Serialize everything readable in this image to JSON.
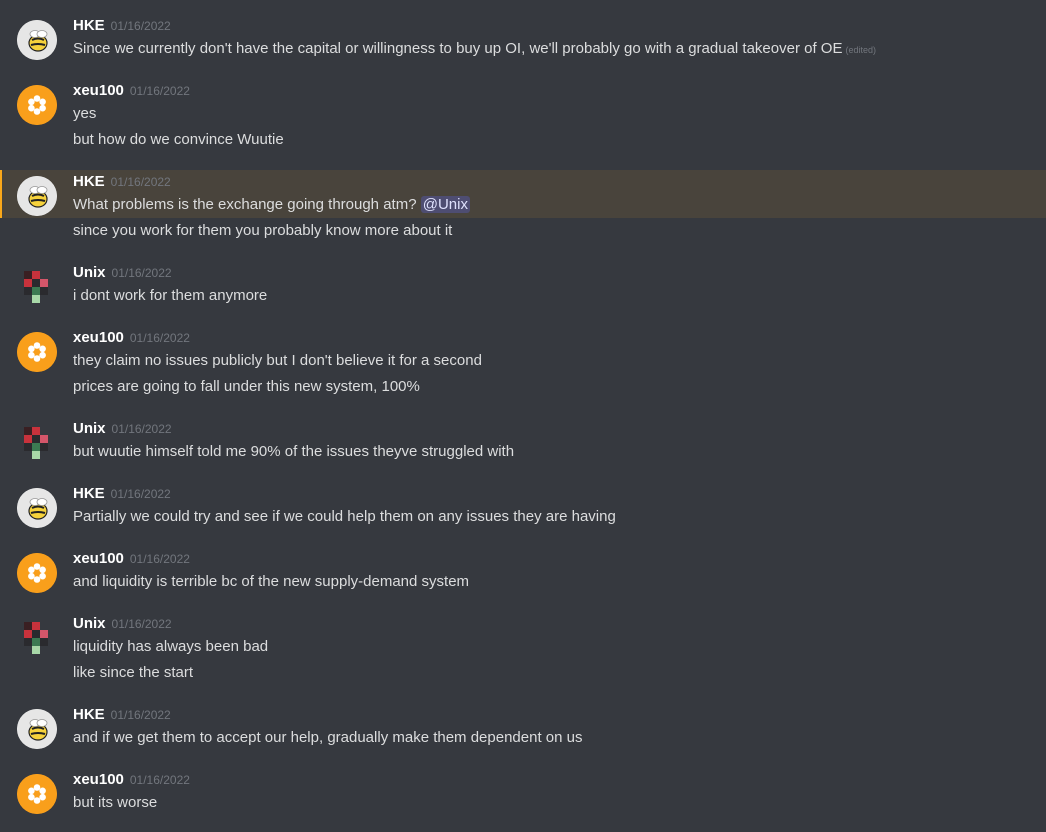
{
  "messages": [
    {
      "author": "HKE",
      "avatar": "bee-avatar",
      "timestamp": "01/16/2022",
      "lines": [
        "Since we currently don't have the capital or willingness to buy up OI, we'll probably go with a gradual takeover of OE"
      ],
      "edited_label": "(edited)"
    },
    {
      "author": "xeu100",
      "avatar": "orange-flower-avatar",
      "timestamp": "01/16/2022",
      "lines": [
        "yes",
        "but how do we convince Wuutie"
      ]
    },
    {
      "author": "HKE",
      "avatar": "bee-avatar",
      "timestamp": "01/16/2022",
      "lines": [
        "What problems is the exchange going through atm?",
        "since you work for them you probably know more about it"
      ],
      "mention": "@Unix",
      "highlighted": true,
      "highlight_color": "#faa81a"
    },
    {
      "author": "Unix",
      "avatar": "pixel-avatar",
      "timestamp": "01/16/2022",
      "lines": [
        "i dont work for them anymore"
      ]
    },
    {
      "author": "xeu100",
      "avatar": "orange-flower-avatar",
      "timestamp": "01/16/2022",
      "lines": [
        "they claim no issues publicly but I don't believe it for a second",
        "prices are going to fall under this new system, 100%"
      ]
    },
    {
      "author": "Unix",
      "avatar": "pixel-avatar",
      "timestamp": "01/16/2022",
      "lines": [
        "but wuutie himself told me 90% of the issues theyve struggled with"
      ]
    },
    {
      "author": "HKE",
      "avatar": "bee-avatar",
      "timestamp": "01/16/2022",
      "lines": [
        "Partially we could try and see if we could help them on any issues they are having"
      ]
    },
    {
      "author": "xeu100",
      "avatar": "orange-flower-avatar",
      "timestamp": "01/16/2022",
      "lines": [
        "and liquidity is terrible bc of the new supply-demand system"
      ]
    },
    {
      "author": "Unix",
      "avatar": "pixel-avatar",
      "timestamp": "01/16/2022",
      "lines": [
        "liquidity has always been bad",
        "like since the start"
      ]
    },
    {
      "author": "HKE",
      "avatar": "bee-avatar",
      "timestamp": "01/16/2022",
      "lines": [
        "and if we get them to accept our help, gradually make them dependent on us"
      ]
    },
    {
      "author": "xeu100",
      "avatar": "orange-flower-avatar",
      "timestamp": "01/16/2022",
      "lines": [
        "but its worse"
      ]
    }
  ],
  "colors": {
    "background": "#36393f",
    "text": "#dcddde",
    "username": "#ffffff",
    "timestamp": "#72767d",
    "xeu_avatar": "#f99f1b",
    "mention_bg": "#414675"
  }
}
